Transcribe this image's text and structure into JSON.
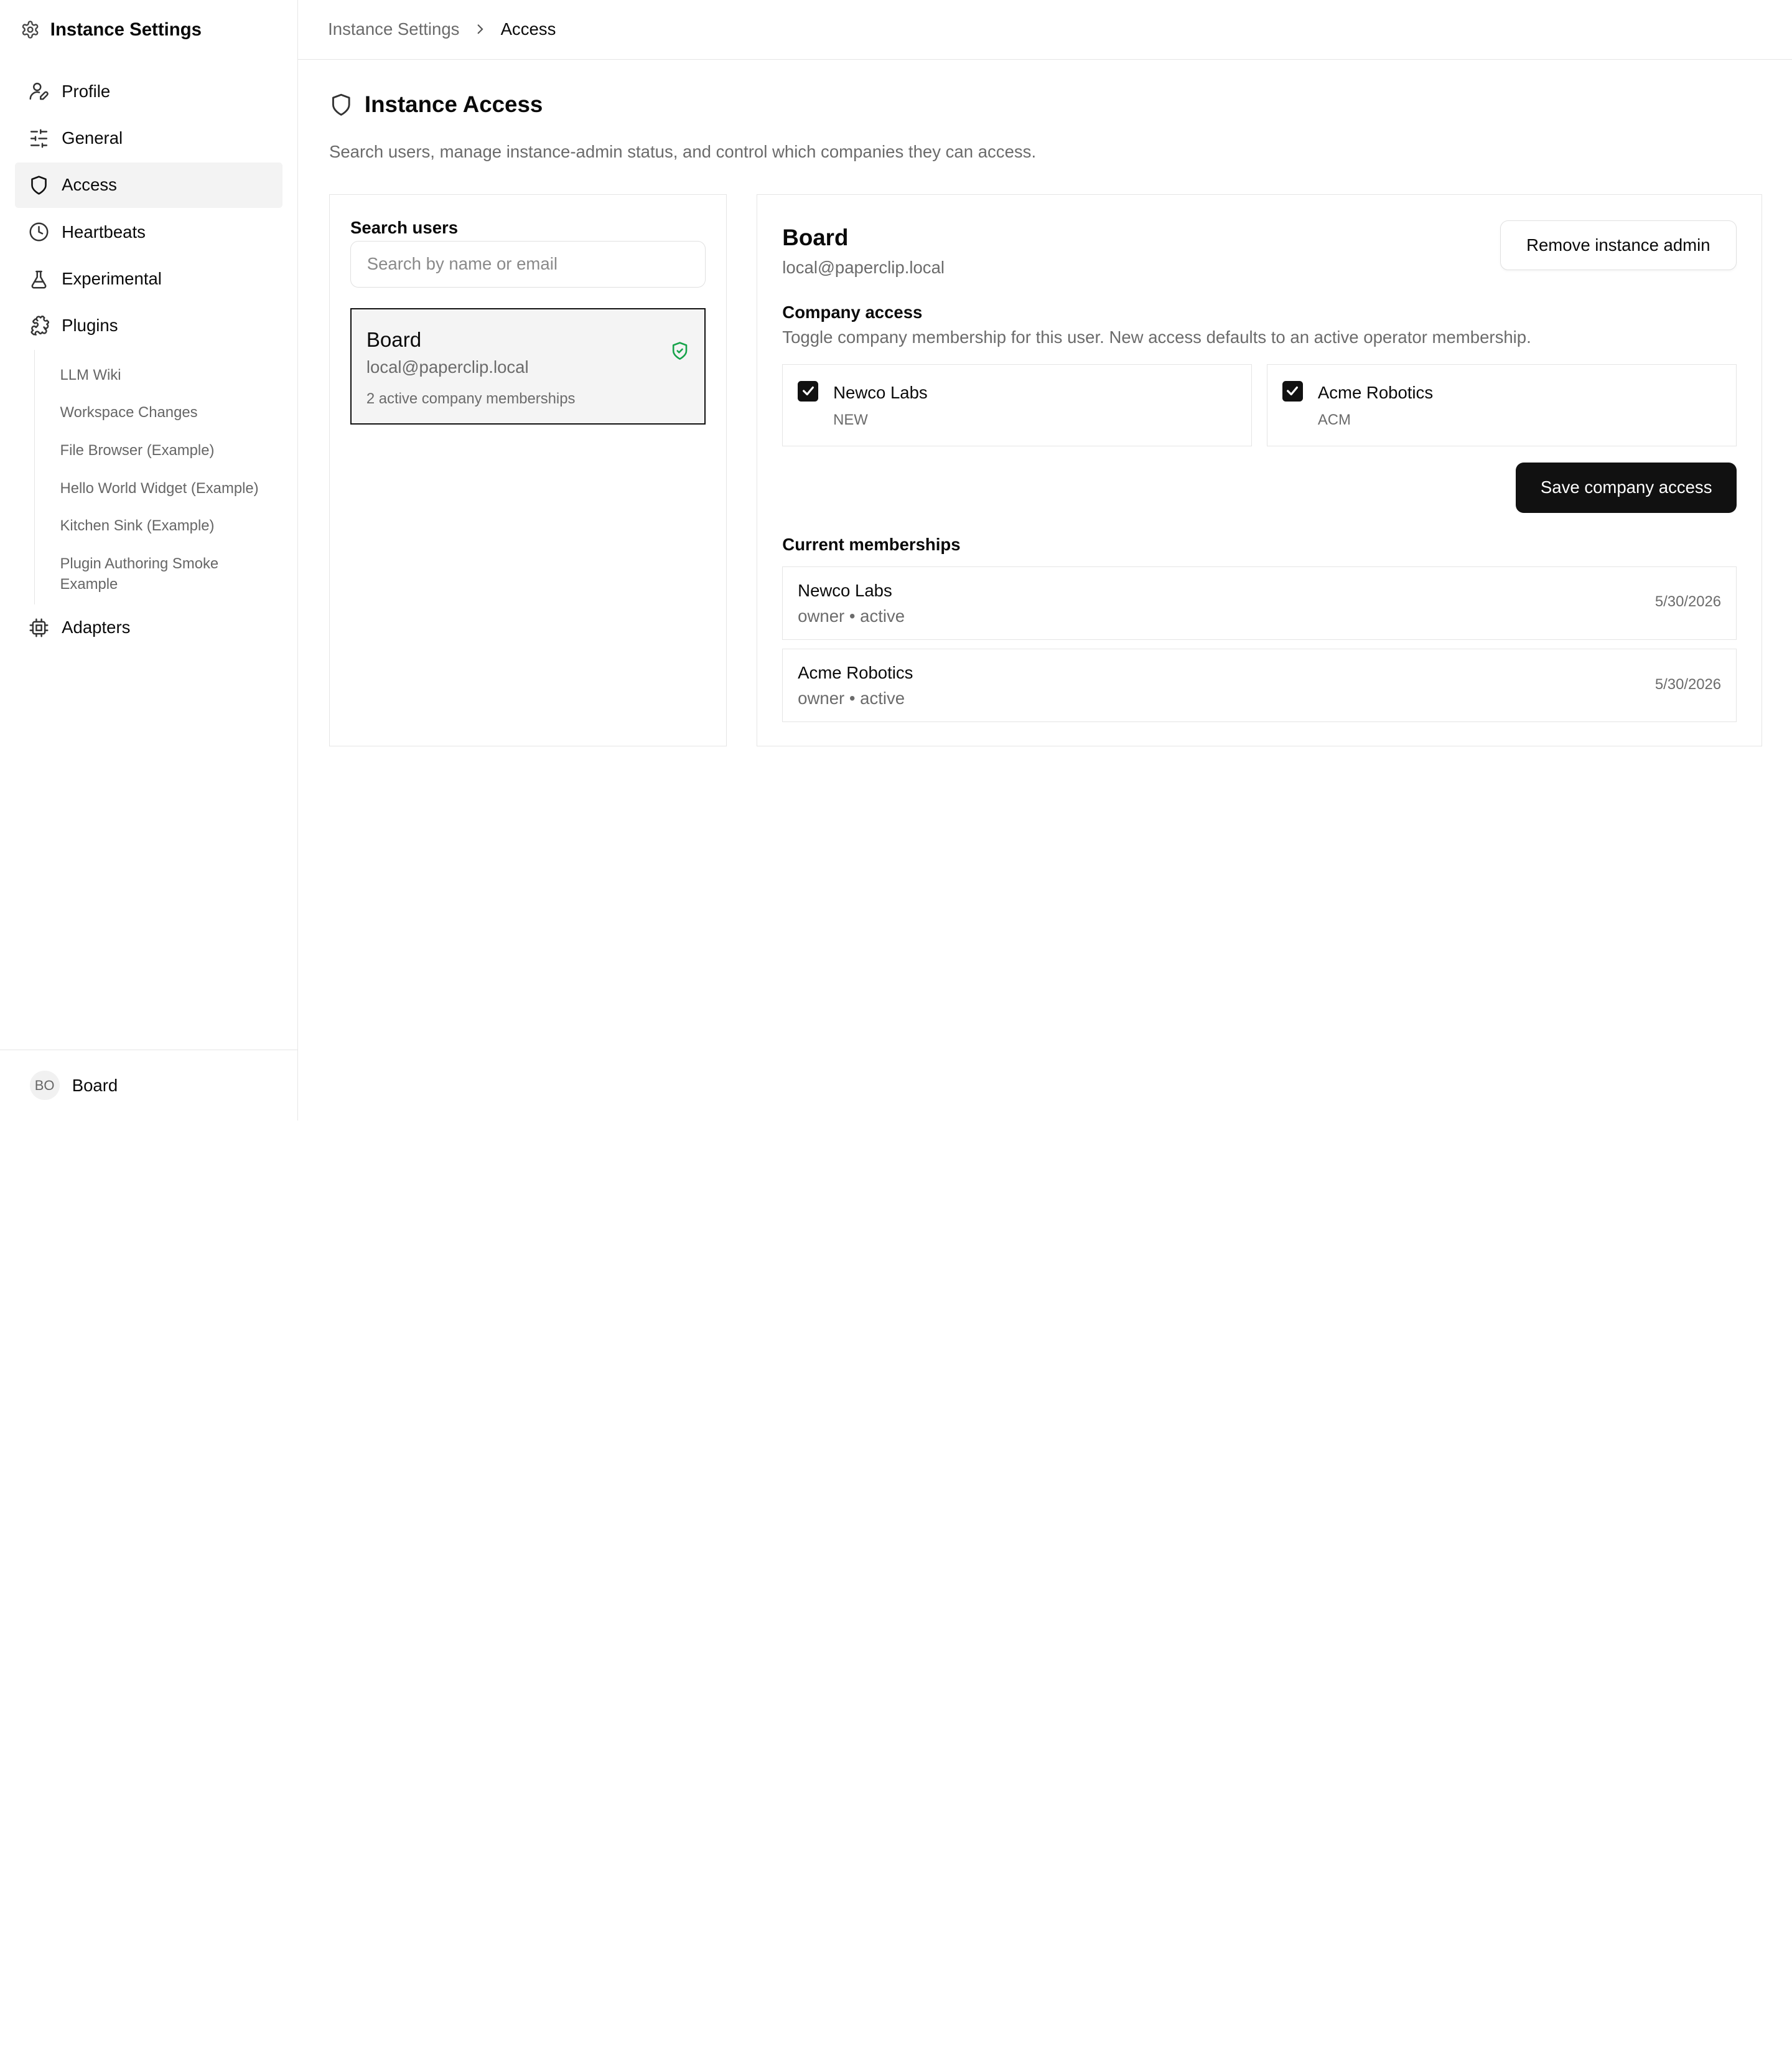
{
  "sidebar": {
    "title": "Instance Settings",
    "nav": [
      {
        "label": "Profile"
      },
      {
        "label": "General"
      },
      {
        "label": "Access",
        "active": true
      },
      {
        "label": "Heartbeats"
      },
      {
        "label": "Experimental"
      },
      {
        "label": "Plugins"
      }
    ],
    "plugins": [
      "LLM Wiki",
      "Workspace Changes",
      "File Browser (Example)",
      "Hello World Widget (Example)",
      "Kitchen Sink (Example)",
      "Plugin Authoring Smoke Example"
    ],
    "adapters_label": "Adapters",
    "footer": {
      "initials": "BO",
      "name": "Board"
    }
  },
  "breadcrumb": {
    "parent": "Instance Settings",
    "current": "Access"
  },
  "page": {
    "title": "Instance Access",
    "description": "Search users, manage instance-admin status, and control which companies they can access."
  },
  "search": {
    "label": "Search users",
    "placeholder": "Search by name or email",
    "value": ""
  },
  "user_list": [
    {
      "name": "Board",
      "email": "local@paperclip.local",
      "memberships": "2 active company memberships",
      "selected": true,
      "admin_badge": "shield-check-icon"
    }
  ],
  "detail": {
    "name": "Board",
    "email": "local@paperclip.local",
    "remove_admin_label": "Remove instance admin",
    "company_access_title": "Company access",
    "company_access_desc": "Toggle company membership for this user. New access defaults to an active operator membership.",
    "companies": [
      {
        "name": "Newco Labs",
        "code": "NEW",
        "checked": true
      },
      {
        "name": "Acme Robotics",
        "code": "ACM",
        "checked": true
      }
    ],
    "save_label": "Save company access",
    "current_memberships_title": "Current memberships",
    "memberships": [
      {
        "company": "Newco Labs",
        "role_status": "owner • active",
        "date": "5/30/2026"
      },
      {
        "company": "Acme Robotics",
        "role_status": "owner • active",
        "date": "5/30/2026"
      }
    ]
  },
  "colors": {
    "accent_dark": "#111111",
    "admin_badge_green": "#16a34a",
    "muted_text": "#6b6b6b",
    "border": "#e5e5e5"
  }
}
